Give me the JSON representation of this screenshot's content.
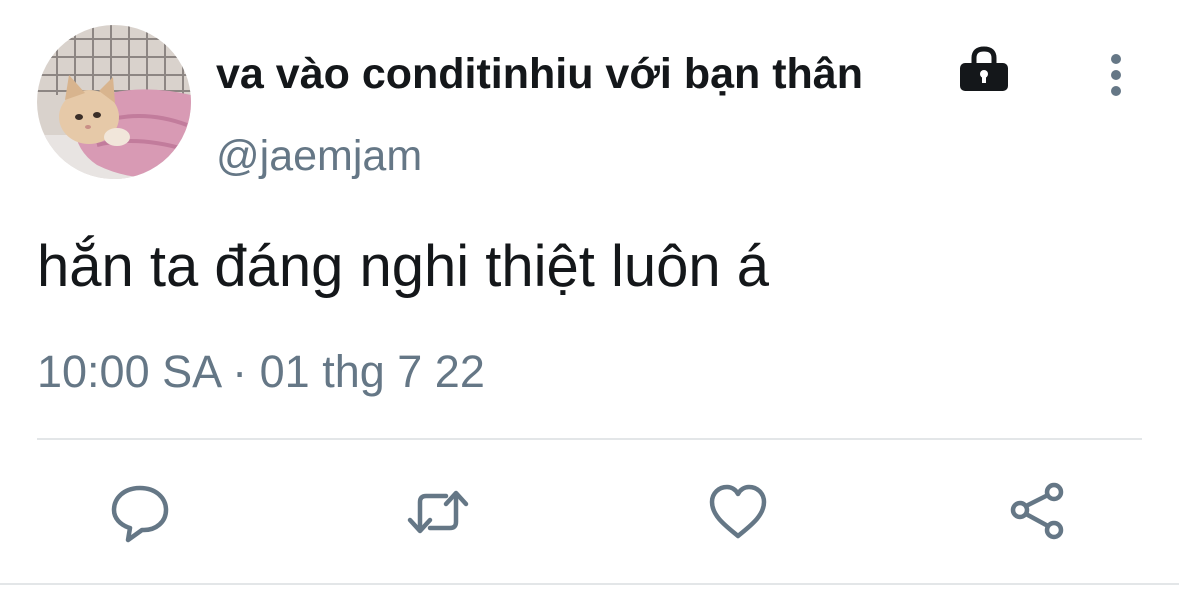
{
  "tweet": {
    "display_name": "va vào conditinhiu với bạn thân",
    "handle": "@jaemjam",
    "text": "hắn ta đáng nghi thiệt luôn á",
    "timestamp": "10:00 SA · 01 thg 7 22"
  },
  "icons": {
    "protected": "lock-icon",
    "more": "more-vertical-icon",
    "reply": "reply-icon",
    "retweet": "retweet-icon",
    "like": "heart-icon",
    "share": "share-icon"
  },
  "colors": {
    "text_primary": "#14171a",
    "text_secondary": "#657786",
    "icon": "#657786",
    "divider": "#e3e6e8"
  }
}
